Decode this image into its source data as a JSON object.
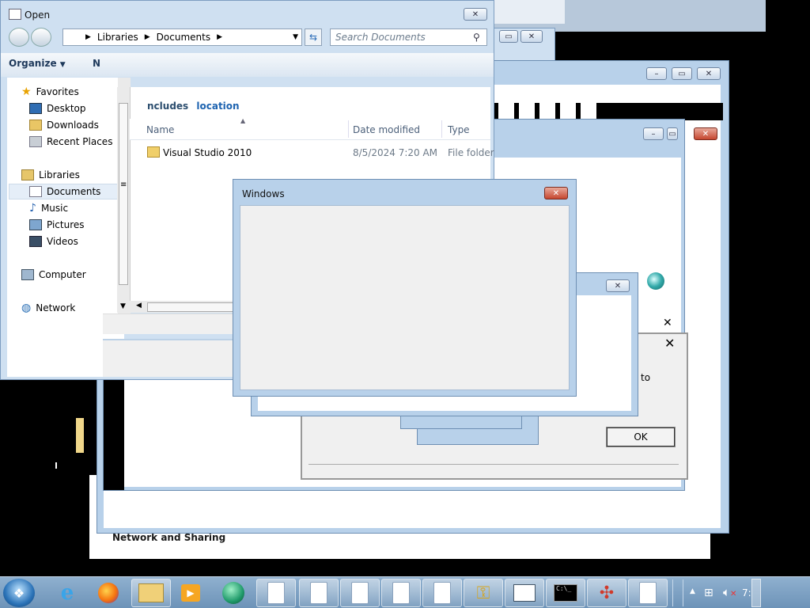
{
  "open_dialog": {
    "title": "Open",
    "breadcrumb": [
      "Libraries",
      "Documents"
    ],
    "search_placeholder": "Search Documents",
    "toolbar_organize": "Organize",
    "toolbar_new": "N",
    "sidebar": {
      "favorites_label": "Favorites",
      "favorites": [
        "Desktop",
        "Downloads",
        "Recent Places"
      ],
      "libraries_label": "Libraries",
      "libraries": [
        "Documents",
        "Music",
        "Pictures",
        "Videos"
      ],
      "computer_label": "Computer",
      "network_label": "Network"
    }
  },
  "file_list": {
    "includes_text": "ncludes",
    "location_link": "location",
    "columns": [
      "Name",
      "Date modified",
      "Type"
    ],
    "rows": [
      {
        "name": "Visual Studio 2010",
        "date": "8/5/2024 7:20 AM",
        "type": "File folder"
      }
    ]
  },
  "windows_dialog": {
    "title": "Windows",
    "close_label": "✕"
  },
  "background_window": {
    "partial_text": "to",
    "ok_label": "OK",
    "network_sharing_label": "Network and Sharing"
  },
  "taskbar": {
    "start_icon": "windows-start-orb",
    "pinned": [
      "internet-explorer-icon",
      "firefox-icon",
      "file-explorer-icon",
      "media-player-icon",
      "green-orb-icon"
    ],
    "clock_partial": "7:"
  }
}
